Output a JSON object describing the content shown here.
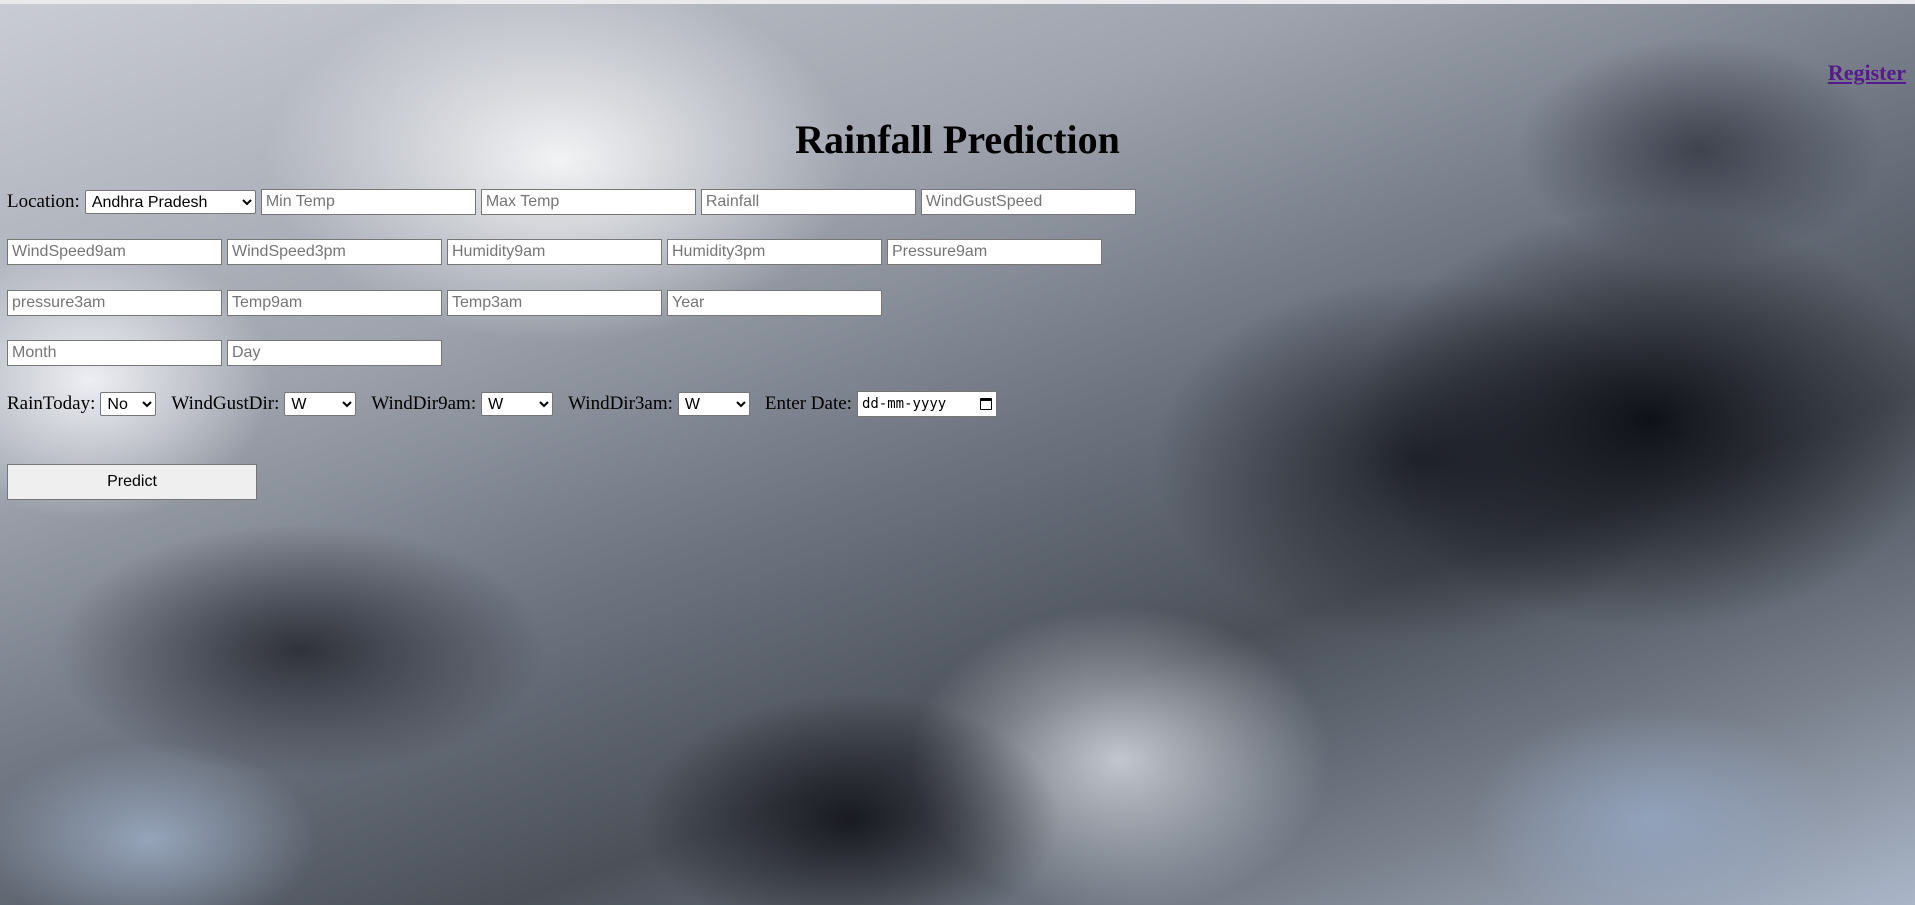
{
  "header": {
    "register_label": "Register",
    "title": "Rainfall Prediction"
  },
  "form": {
    "location_label": "Location:",
    "location_value": "Andhra Pradesh",
    "placeholders": {
      "min_temp": "Min Temp",
      "max_temp": "Max Temp",
      "rainfall": "Rainfall",
      "wind_gust_speed": "WindGustSpeed",
      "wind_speed_9am": "WindSpeed9am",
      "wind_speed_3pm": "WindSpeed3pm",
      "humidity_9am": "Humidity9am",
      "humidity_3pm": "Humidity3pm",
      "pressure_9am": "Pressure9am",
      "pressure_3pm": "pressure3am",
      "temp_9am": "Temp9am",
      "temp_3pm": "Temp3am",
      "year": "Year",
      "month": "Month",
      "day": "Day"
    },
    "rain_today_label": "RainToday:",
    "rain_today_value": "No",
    "wind_gust_dir_label": "WindGustDir:",
    "wind_gust_dir_value": "W",
    "wind_dir_9am_label": "WindDir9am:",
    "wind_dir_9am_value": "W",
    "wind_dir_3pm_label": "WindDir3am:",
    "wind_dir_3pm_value": "W",
    "date_label": "Enter Date:",
    "date_placeholder": "dd-mm-yyyy",
    "predict_label": "Predict"
  },
  "icons": {
    "calendar": "calendar-icon"
  }
}
